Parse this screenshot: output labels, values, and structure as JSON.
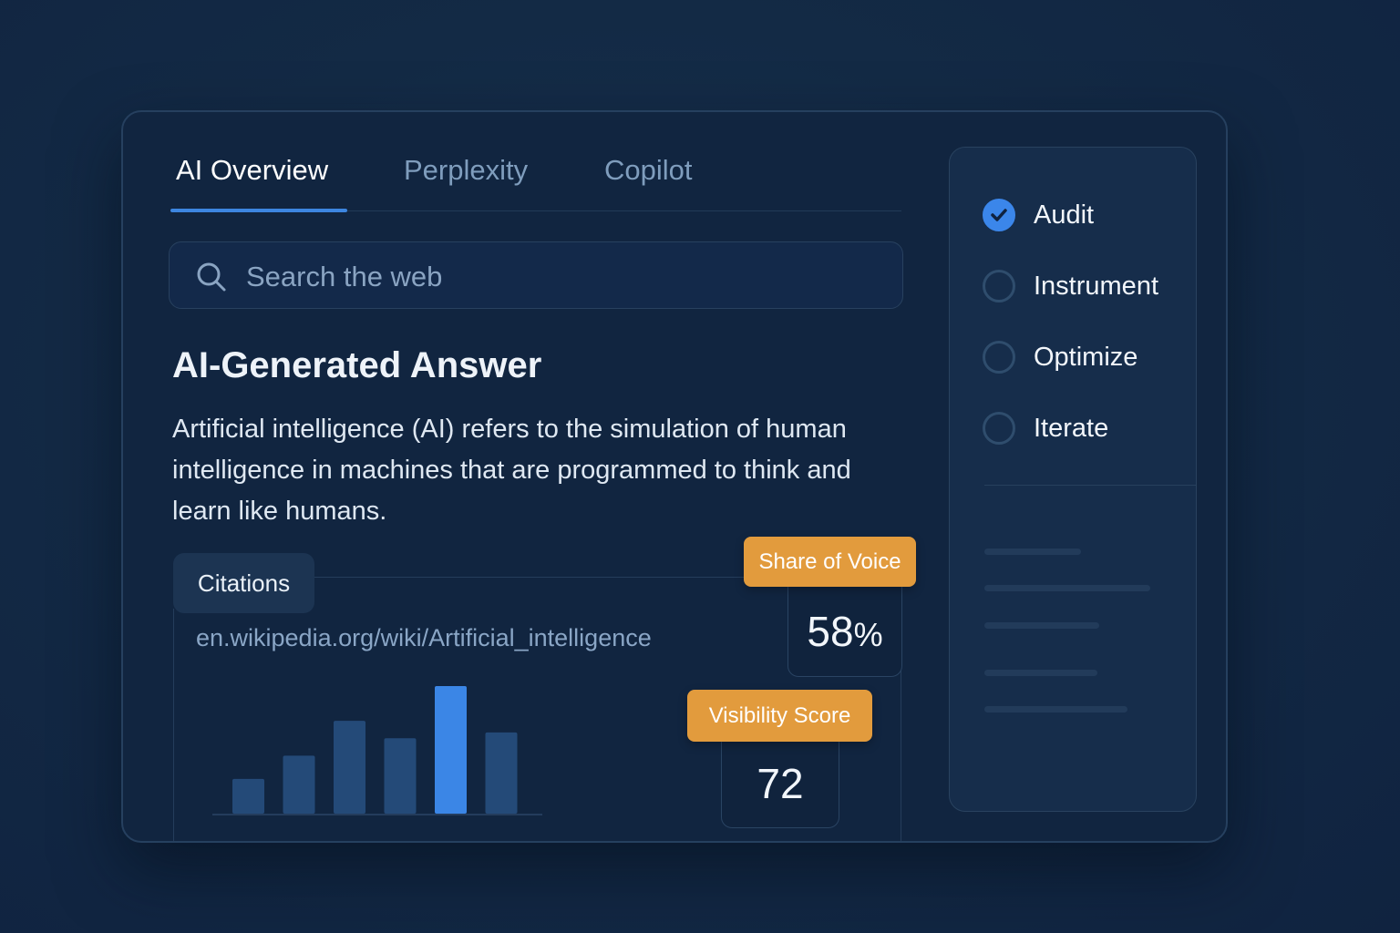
{
  "tabs": [
    {
      "label": "AI Overview",
      "active": true
    },
    {
      "label": "Perplexity",
      "active": false
    },
    {
      "label": "Copilot",
      "active": false
    }
  ],
  "search": {
    "placeholder": "Search the web",
    "icon": "search-icon"
  },
  "answer": {
    "title": "AI-Generated Answer",
    "body": "Artificial intelligence (AI) refers to the simulation of human intelligence in machines that are programmed to think and learn like humans."
  },
  "citations": {
    "label": "Citations",
    "link": "en.wikipedia.org/wiki/Artificial_intelligence"
  },
  "chart_data": {
    "type": "bar",
    "values": [
      3,
      5,
      8,
      6.5,
      11,
      7
    ],
    "highlight_index": 4,
    "colors": {
      "bar": "#244a78",
      "highlight": "#3b86e6",
      "axis": "#2b4566"
    }
  },
  "metrics": {
    "share_of_voice": {
      "label": "Share of Voice",
      "value": "58",
      "unit": "%"
    },
    "visibility_score": {
      "label": "Visibility Score",
      "value": "72"
    }
  },
  "steps": [
    {
      "label": "Audit",
      "done": true
    },
    {
      "label": "Instrument",
      "done": false
    },
    {
      "label": "Optimize",
      "done": false
    },
    {
      "label": "Iterate",
      "done": false
    }
  ],
  "colors": {
    "accent": "#3d86e0",
    "tag": "#e29b3d",
    "background": "#132a45"
  }
}
